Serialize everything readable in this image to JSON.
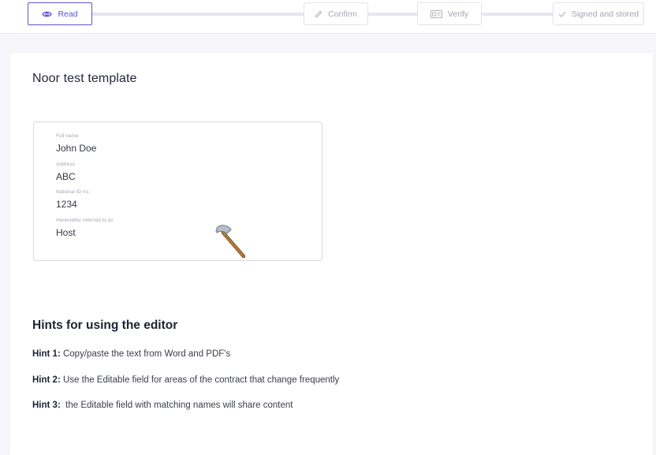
{
  "steps": [
    {
      "label": "Read",
      "icon": "eye-icon",
      "active": true
    },
    {
      "label": "Confirm",
      "icon": "pencil-icon",
      "active": false
    },
    {
      "label": "Verify",
      "icon": "id-card-icon",
      "active": false
    },
    {
      "label": "Signed and stored",
      "icon": "check-icon",
      "active": false
    }
  ],
  "document": {
    "title": "Noor test template",
    "fields": [
      {
        "label": "Full name",
        "value": "John Doe"
      },
      {
        "label": "Address",
        "value": "ABC"
      },
      {
        "label": "National ID no.",
        "value": "1234"
      },
      {
        "label": "Hereinafter referred to as",
        "value": "Host"
      }
    ]
  },
  "hints": {
    "title": "Hints for using the editor",
    "items": [
      {
        "prefix": "Hint 1:",
        "text": " Copy/paste the text from Word and PDF's"
      },
      {
        "prefix": "Hint 2:",
        "text": " Use the Editable field for areas of the contract that change frequently"
      },
      {
        "prefix": "Hint 3:",
        "text": "  the Editable field with matching names will share content"
      }
    ]
  },
  "colors": {
    "accent": "#5b54d6",
    "inactive": "#a3a6b2"
  }
}
